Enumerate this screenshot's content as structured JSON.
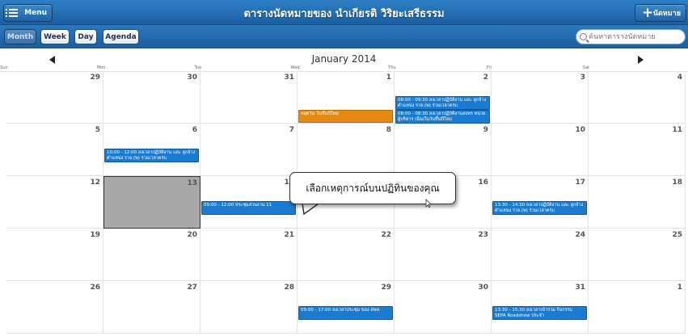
{
  "header": {
    "menu_label": "Menu",
    "title": "ตารางนัดหมายของ นำเกียรติ วิริยะเสรีธรรม",
    "new_label": "นัดหมาย"
  },
  "toolbar": {
    "views": [
      "Month",
      "Week",
      "Day",
      "Agenda"
    ],
    "active_view": "Month",
    "search_placeholder": "ค้นหาตารางนัดหมาย"
  },
  "calendar": {
    "month_label": "January 2014",
    "days_of_week": [
      "Sun",
      "Mon",
      "Tue",
      "Wed",
      "Thu",
      "Fri",
      "Sat"
    ],
    "weeks": [
      [
        "29",
        "30",
        "31",
        "1",
        "2",
        "3",
        "4"
      ],
      [
        "5",
        "6",
        "7",
        "8",
        "9",
        "10",
        "11"
      ],
      [
        "12",
        "13",
        "14",
        "15",
        "16",
        "17",
        "18"
      ],
      [
        "19",
        "20",
        "21",
        "22",
        "23",
        "24",
        "25"
      ],
      [
        "26",
        "27",
        "28",
        "29",
        "30",
        "31",
        "1"
      ]
    ],
    "selected_day": "13",
    "events": [
      {
        "week": 0,
        "day": 3,
        "slot": 1,
        "color": "orange",
        "text": "หยุดวัน วันขึ้นปีใหม่"
      },
      {
        "week": 0,
        "day": 4,
        "slot": 0,
        "color": "blue",
        "text": "08:00 - 09:30 ลงเวลาปฏิบัติงาน และ ลูกจ้างตำแหน่ง รวจ.(พ) ร่วมเวลาครบ"
      },
      {
        "week": 0,
        "day": 4,
        "slot": 1,
        "color": "blue",
        "text": "08:00 - 08:30 ลงเวลาปฏิบัติงานลงพร หน่วยผู้บริหาร เนื่องในวันขึ้นปีใหม่"
      },
      {
        "week": 1,
        "day": 1,
        "slot": 0,
        "color": "blue",
        "text": "10:00 - 12:00 ลงเวลาปฏิบัติงาน และ ลูกจ้างตำแหน่ง รวจ.(พ) ร่วมเวลาครบ"
      },
      {
        "week": 2,
        "day": 2,
        "slot": 0,
        "color": "blue",
        "text": "09:00 - 12:00 ประชุมส่วนงาน 11"
      },
      {
        "week": 2,
        "day": 5,
        "slot": 0,
        "color": "blue",
        "text": "13:30 - 14:30 ลงเวลาปฏิบัติงาน และ ลูกจ้างตำแหน่ง รวจ.(พ) ร่วมเวลาครบ"
      },
      {
        "week": 4,
        "day": 3,
        "slot": 0,
        "color": "blue",
        "text": "09:00 - 17:00 ลงเวลาประชุม ของ สพท."
      },
      {
        "week": 4,
        "day": 5,
        "slot": 0,
        "color": "blue",
        "text": "13:30 - 15:30 ลงเวลาเข้าร่วม กิจกรรม SEPA Roadshow ประจำ"
      }
    ]
  },
  "tooltip": {
    "text": "เลือกเหตุการณ์บนปฏิทินของคุณ"
  },
  "colors": {
    "header_blue": "#1f6db5",
    "event_blue": "#1a7bd0",
    "event_orange": "#e58a0f",
    "selected_gray": "#a8a8a8"
  }
}
